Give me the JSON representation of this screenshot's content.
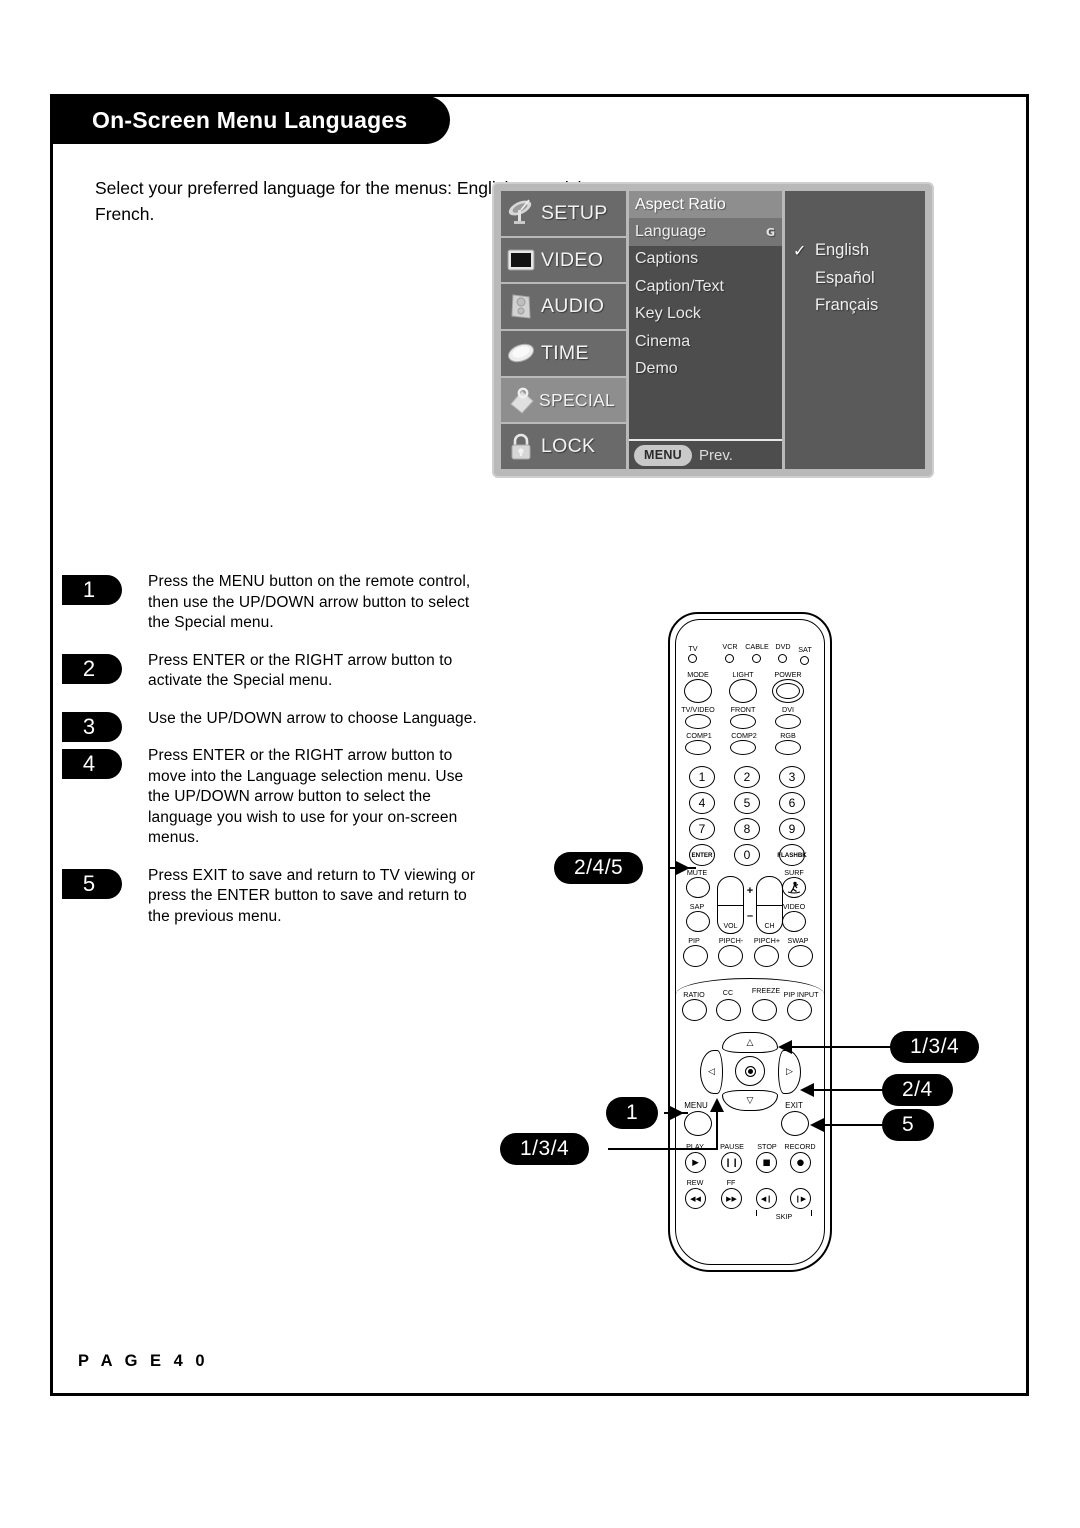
{
  "page": {
    "title": "On-Screen Menu Languages",
    "intro": "Select your preferred language for the menus: English, Spanish, or French.",
    "page_number": "P A G E   4 0"
  },
  "osd": {
    "rail": [
      {
        "label": "SETUP",
        "icon": "satellite-dish-icon",
        "active": false
      },
      {
        "label": "VIDEO",
        "icon": "tv-screen-icon",
        "active": false
      },
      {
        "label": "AUDIO",
        "icon": "speaker-icon",
        "active": false
      },
      {
        "label": "TIME",
        "icon": "clock-disc-icon",
        "active": false
      },
      {
        "label": "SPECIAL",
        "icon": "tag-icon",
        "active": true
      },
      {
        "label": "LOCK",
        "icon": "padlock-icon",
        "active": false
      }
    ],
    "submenu": [
      {
        "label": "Aspect Ratio",
        "marker": "",
        "state": "first"
      },
      {
        "label": "Language",
        "marker": "G",
        "state": "selected"
      },
      {
        "label": "Captions",
        "marker": "",
        "state": "normal"
      },
      {
        "label": "Caption/Text",
        "marker": "",
        "state": "normal"
      },
      {
        "label": "Key Lock",
        "marker": "",
        "state": "normal"
      },
      {
        "label": "Cinema",
        "marker": "",
        "state": "normal"
      },
      {
        "label": "Demo",
        "marker": "",
        "state": "normal"
      }
    ],
    "footer": {
      "key": "MENU",
      "action": "Prev."
    },
    "languages": [
      {
        "label": "English",
        "checked": true,
        "check": "✓"
      },
      {
        "label": "Español",
        "checked": false,
        "check": ""
      },
      {
        "label": "Français",
        "checked": false,
        "check": ""
      }
    ],
    "colors": {
      "bezel": "#b9b9b9",
      "rail": "#6a6a6a",
      "rail_active": "#8e8e8e",
      "submenu": "#4d4d4d",
      "submenu_header": "#8e8e8e",
      "submenu_selected": "#757575",
      "panel": "#5a5a5a"
    }
  },
  "steps": [
    {
      "num": "1",
      "text": "Press the MENU button on the remote control, then use the UP/DOWN arrow button to select the Special menu."
    },
    {
      "num": "2",
      "text": "Press ENTER or the RIGHT arrow button to activate the Special menu."
    },
    {
      "num": "3",
      "text": "Use the UP/DOWN arrow to choose Language."
    },
    {
      "num": "4",
      "text": "Press ENTER or the RIGHT arrow button to move into the Language selection menu. Use the UP/DOWN arrow button to select the language you wish to use for your on-screen menus."
    },
    {
      "num": "5",
      "text": "Press EXIT to save and return to TV viewing or press the ENTER button to save and return to the previous menu."
    }
  ],
  "callouts": [
    {
      "id": "enter-callout",
      "label": "2/4/5",
      "target": "ENTER button"
    },
    {
      "id": "up-arrow-callout",
      "label": "1/3/4",
      "target": "UP arrow"
    },
    {
      "id": "right-arrow-callout",
      "label": "2/4",
      "target": "RIGHT arrow"
    },
    {
      "id": "exit-callout",
      "label": "5",
      "target": "EXIT button"
    },
    {
      "id": "menu-callout",
      "label": "1",
      "target": "MENU button"
    },
    {
      "id": "down-arrow-callout",
      "label": "1/3/4",
      "target": "DOWN arrow"
    }
  ],
  "remote": {
    "mode_leds": [
      "TV",
      "VCR",
      "CABLE",
      "DVD",
      "SAT"
    ],
    "row_mode": [
      "MODE",
      "LIGHT",
      "POWER"
    ],
    "row_input1": [
      "TV/VIDEO",
      "FRONT",
      "DVI"
    ],
    "row_input2": [
      "COMP1",
      "COMP2",
      "RGB"
    ],
    "keypad": [
      "1",
      "2",
      "3",
      "4",
      "5",
      "6",
      "7",
      "8",
      "9",
      "ENTER",
      "0",
      "FLASHBK"
    ],
    "row_mute": [
      "MUTE",
      "SURF"
    ],
    "row_sap": [
      "SAP",
      "VIDEO"
    ],
    "rockers": [
      "VOL",
      "CH"
    ],
    "rocker_signs": [
      "+",
      "–"
    ],
    "row_pip": [
      "PIP",
      "PIPCH-",
      "PIPCH+",
      "SWAP"
    ],
    "row_ratio": [
      "RATIO",
      "CC",
      "FREEZE",
      "PIP INPUT"
    ],
    "dpad": {
      "up": "△",
      "down": "▽",
      "left": "◁",
      "right": "▷",
      "center": "◉"
    },
    "menu_label": "MENU",
    "exit_label": "EXIT",
    "row_play": [
      "PLAY",
      "PAUSE",
      "STOP",
      "RECORD"
    ],
    "row_play_glyphs": [
      "▶",
      "❙❙",
      "■",
      "●"
    ],
    "row_rew": [
      "REW",
      "FF"
    ],
    "row_rew_glyphs": [
      "◀◀",
      "▶▶",
      "◀❙",
      "❙▶"
    ],
    "skip_label": "SKIP"
  }
}
